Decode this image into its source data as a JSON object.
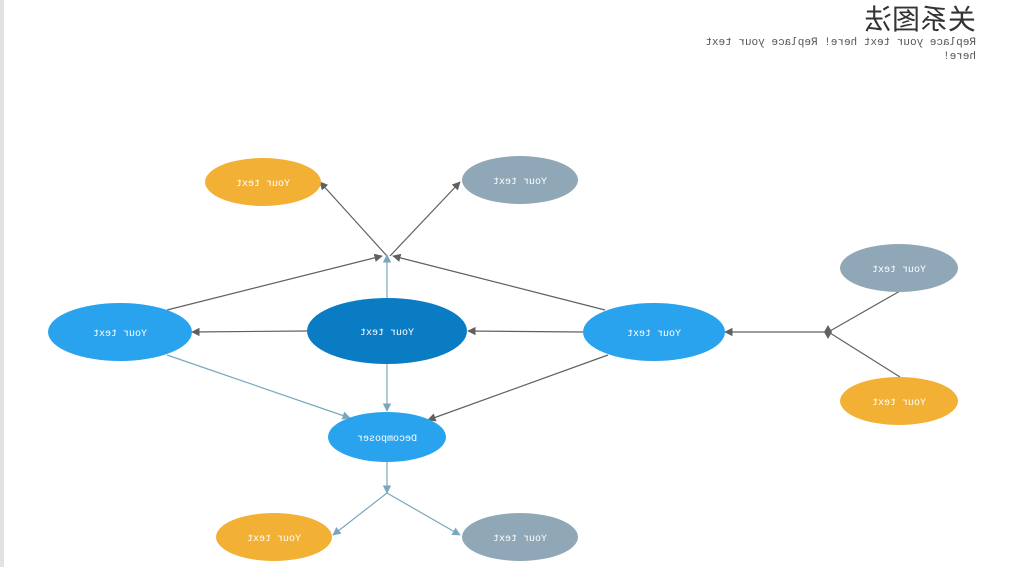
{
  "header": {
    "title": "关系图法",
    "subtitle": "Replace your text here!  Replace your text here!"
  },
  "colors": {
    "primary_dark": "#0a7cc4",
    "primary": "#29a3ee",
    "orange": "#f2b135",
    "slate": "#8fa7b6",
    "arrow_dark": "#606060",
    "arrow_light": "#7aa7bd"
  },
  "nodes": {
    "center": {
      "label": "Your text"
    },
    "left": {
      "label": "Your text"
    },
    "right": {
      "label": "Your text"
    },
    "top_orange": {
      "label": "Your text"
    },
    "top_slate": {
      "label": "Your text"
    },
    "far_right_slate": {
      "label": "Your text"
    },
    "far_right_orange": {
      "label": "Your text"
    },
    "decomposer": {
      "label": "Decomposer"
    },
    "bottom_orange": {
      "label": "Your text"
    },
    "bottom_slate": {
      "label": "Your text"
    }
  }
}
